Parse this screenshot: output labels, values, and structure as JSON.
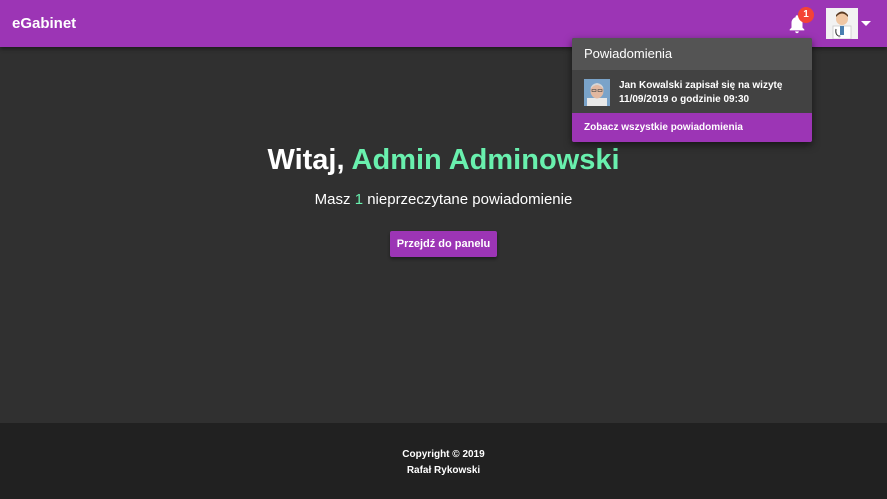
{
  "app": {
    "title": "eGabinet"
  },
  "header": {
    "notification_count": "1",
    "icons": {
      "bell": "bell-icon",
      "avatar": "user-avatar",
      "menu": "caret-down-icon"
    }
  },
  "notifications": {
    "header": "Powiadomienia",
    "items": [
      {
        "line1": "Jan Kowalski zapisał się na wizytę",
        "line2": "11/09/2019 o godzinie 09:30",
        "avatar": "patient-photo"
      }
    ],
    "see_all": "Zobacz wszystkie powiadomienia"
  },
  "main": {
    "greeting": "Witaj,",
    "user_name": "Admin Adminowski",
    "sub_prefix": "Masz",
    "unread_count": "1",
    "sub_suffix": "nieprzeczytane powiadomienie",
    "button_label": "Przejdź do panelu"
  },
  "footer": {
    "copyright": "Copyright © 2019",
    "author": "Rafał Rykowski"
  },
  "colors": {
    "primary": "#9c35b5",
    "accent": "#69f0ae",
    "background": "#303030",
    "footer": "#212121",
    "badge": "#f44336"
  }
}
